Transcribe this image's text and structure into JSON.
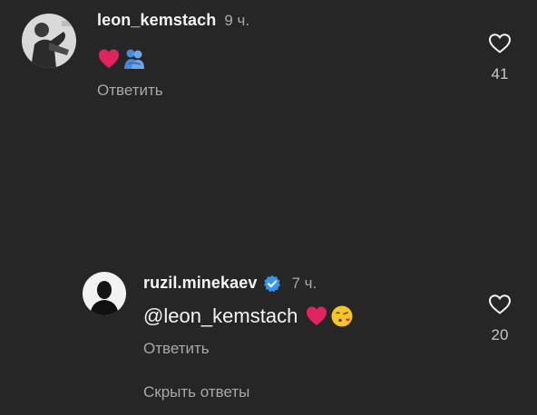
{
  "comments": [
    {
      "username": "leon_kemstach",
      "time": "9 ч.",
      "text": "",
      "emojis": [
        "red-heart",
        "people-hugging"
      ],
      "reply_label": "Ответить",
      "likes": "41"
    },
    {
      "username": "ruzil.minekaev",
      "verified": true,
      "time": "7 ч.",
      "text": "@leon_kemstach",
      "emojis": [
        "red-heart",
        "face-blowing-kiss"
      ],
      "reply_label": "Ответить",
      "likes": "20"
    }
  ],
  "hide_replies_label": "Скрыть ответы",
  "colors": {
    "background": "#262626",
    "primary_text": "#f5f5f5",
    "secondary_text": "#a8a8a8",
    "verified_badge": "#3797f0",
    "heart_emoji": "#e0245e"
  }
}
